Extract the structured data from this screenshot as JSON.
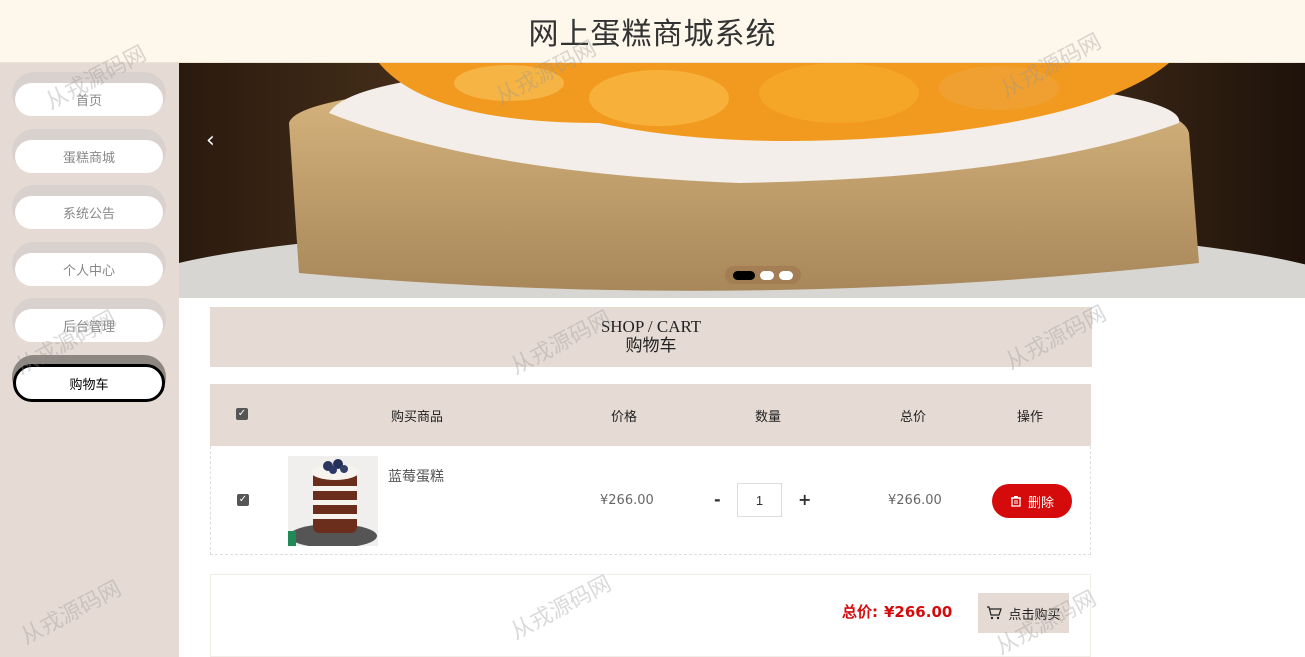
{
  "header": {
    "title": "网上蛋糕商城系统"
  },
  "sidebar": {
    "items": [
      {
        "label": "首页"
      },
      {
        "label": "蛋糕商城"
      },
      {
        "label": "系统公告"
      },
      {
        "label": "个人中心"
      },
      {
        "label": "后台管理"
      },
      {
        "label": "购物车",
        "active": true
      }
    ]
  },
  "banner": {
    "prev_icon": "chevron-left-icon",
    "slides": 3,
    "active_slide": 1
  },
  "section": {
    "title_en": "SHOP / CART",
    "title_cn": "购物车"
  },
  "table": {
    "headers": {
      "product": "购买商品",
      "price": "价格",
      "quantity": "数量",
      "total": "总价",
      "action": "操作"
    },
    "rows": [
      {
        "checked": true,
        "name": "蓝莓蛋糕",
        "price": "¥266.00",
        "quantity": "1",
        "total": "¥266.00",
        "delete_label": "删除"
      }
    ],
    "minus_label": "-",
    "plus_label": "+"
  },
  "footer": {
    "total_label": "总价:",
    "total_value": "¥266.00",
    "buy_label": "点击购买"
  },
  "watermark": "从戎源码网",
  "colors": {
    "accent": "#d50b0b",
    "panel": "#e6dbd4",
    "header_bg": "#fdf7ec"
  }
}
